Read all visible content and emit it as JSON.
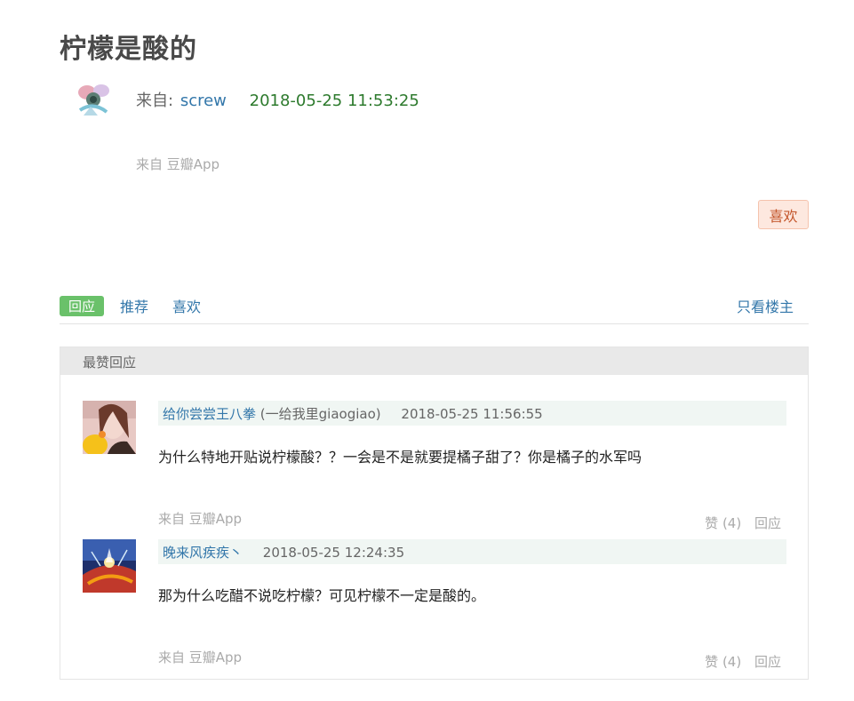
{
  "post": {
    "title": "柠檬是酸的",
    "from_label": "来自:",
    "author": "screw",
    "time": "2018-05-25 11:53:25",
    "via": "来自 豆瓣App",
    "like_label": "喜欢"
  },
  "tabs": {
    "reply": "回应",
    "recommend": "推荐",
    "like": "喜欢",
    "op_only": "只看楼主"
  },
  "best": {
    "header": "最赞回应",
    "comments": [
      {
        "name": "给你尝尝王八拳",
        "sub": "(一给我里giaogiao)",
        "time": "2018-05-25 11:56:55",
        "text": "为什么特地开贴说柠檬酸？？一会是不是就要提橘子甜了？你是橘子的水军吗",
        "via": "来自 豆瓣App",
        "likes": "赞 (4)",
        "reply": "回应"
      },
      {
        "name": "晚来风疾疾丶",
        "sub": "",
        "time": "2018-05-25 12:24:35",
        "text": "那为什么吃醋不说吃柠檬？可见柠檬不一定是酸的。",
        "via": "来自 豆瓣App",
        "likes": "赞 (4)",
        "reply": "回应"
      }
    ]
  }
}
